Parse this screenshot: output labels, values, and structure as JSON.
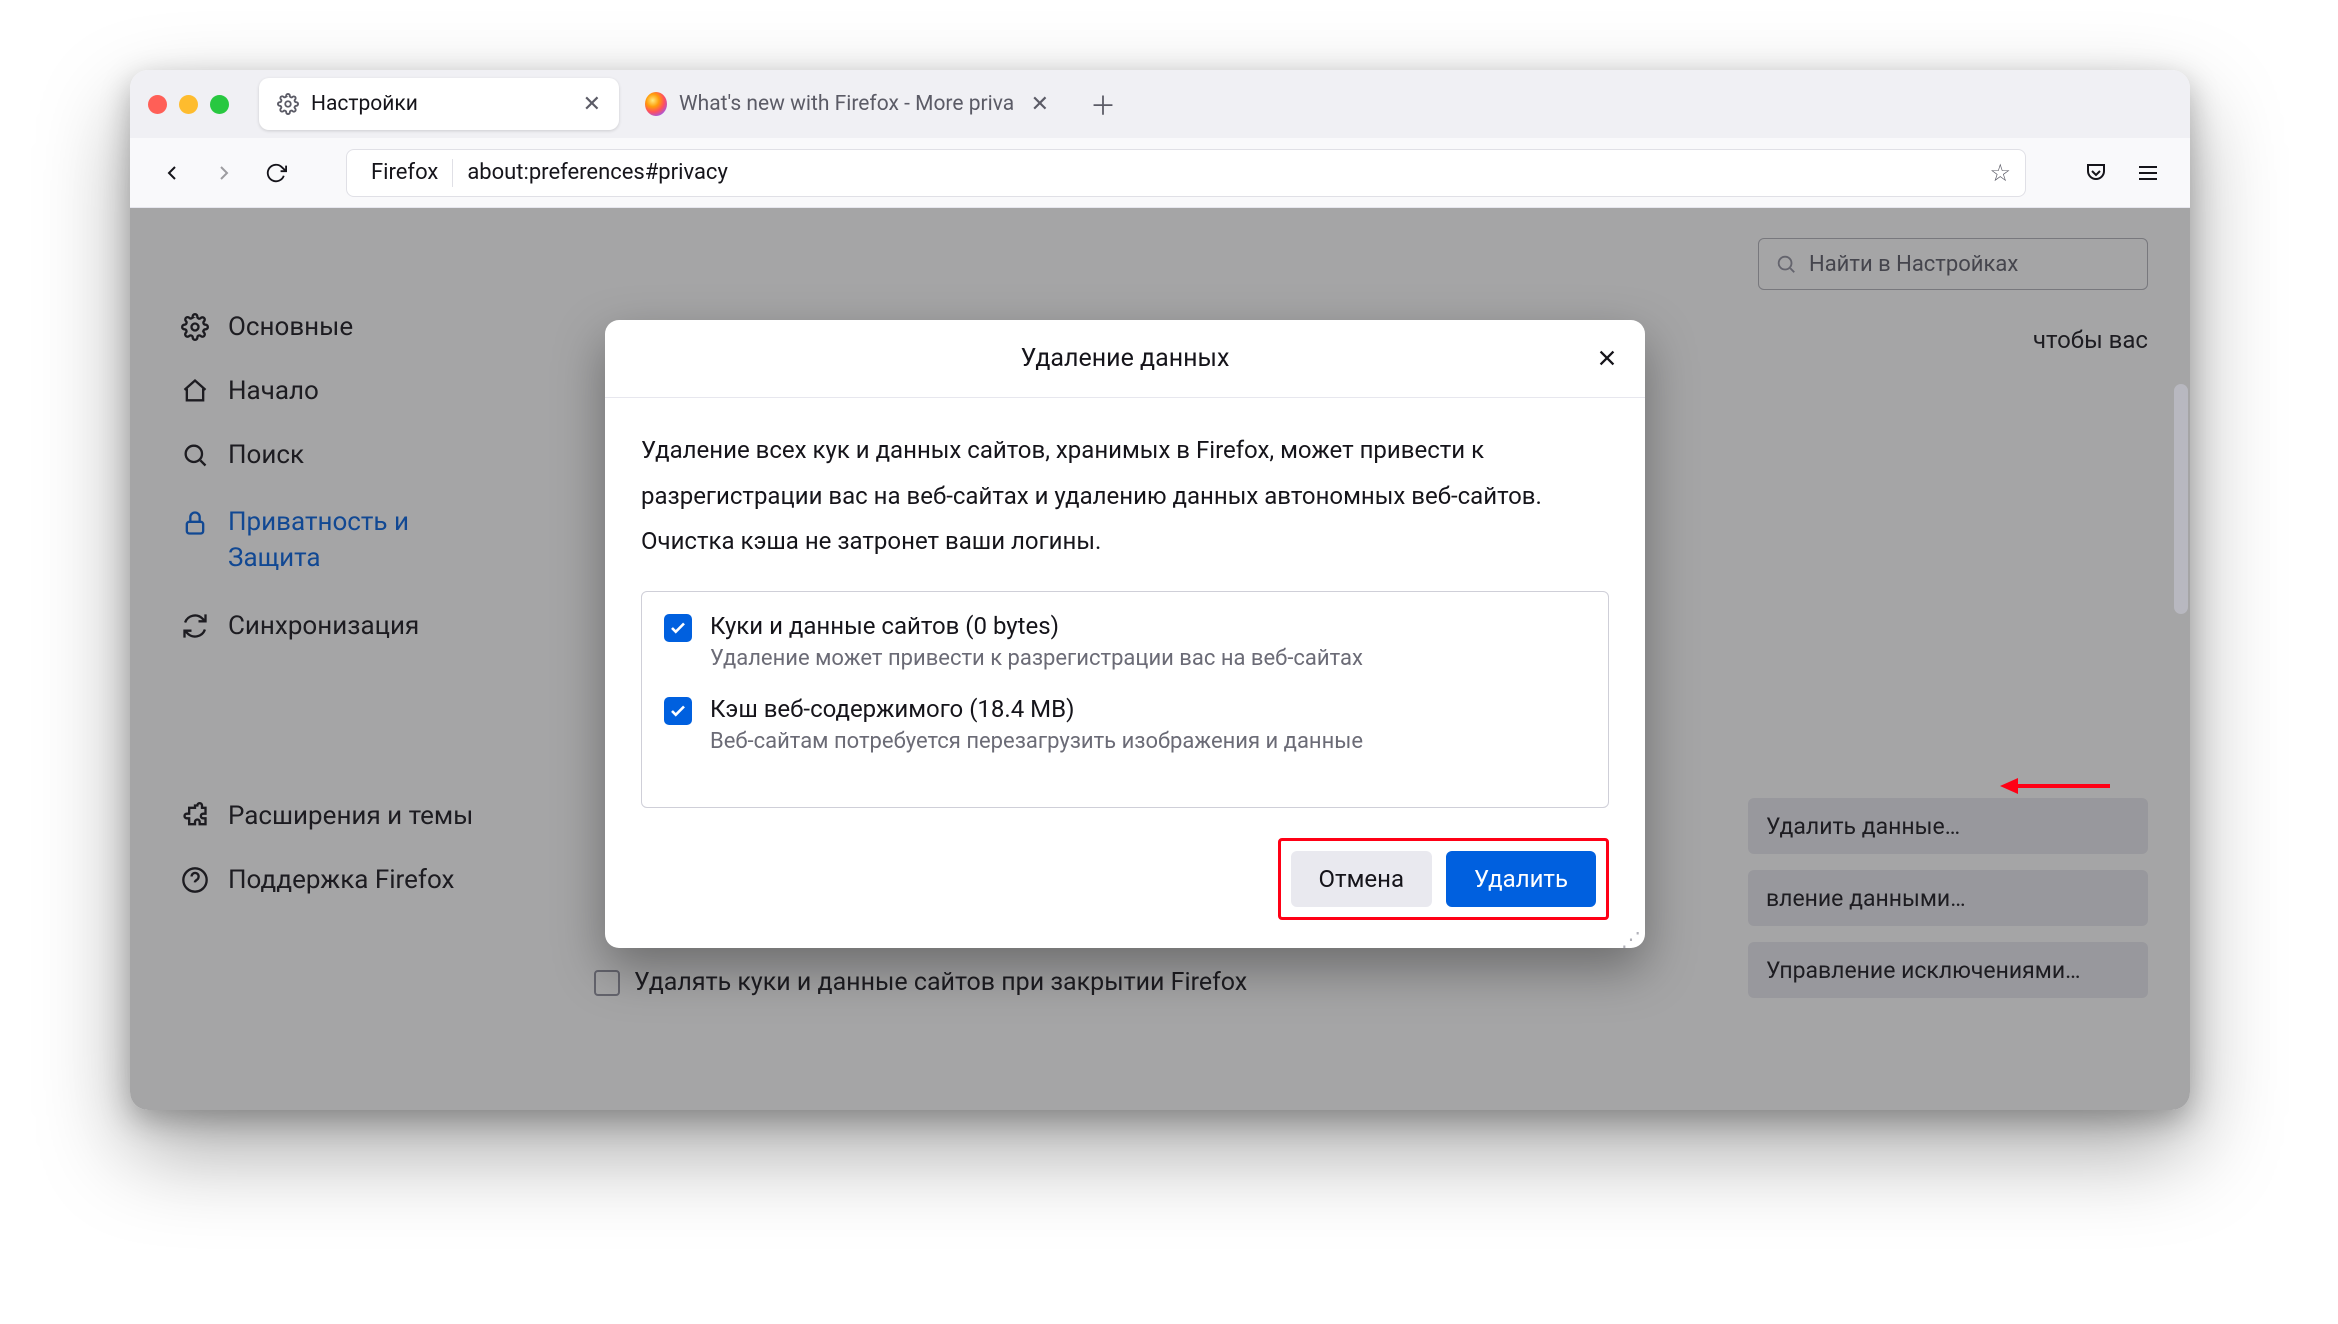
{
  "tabs": [
    {
      "label": "Настройки",
      "active": true
    },
    {
      "label": "What's new with Firefox - More priva",
      "active": false
    }
  ],
  "url": {
    "identity": "Firefox",
    "address": "about:preferences#privacy"
  },
  "search": {
    "placeholder": "Найти в Настройках"
  },
  "sidebar": {
    "items": [
      {
        "label": "Основные"
      },
      {
        "label": "Начало"
      },
      {
        "label": "Поиск"
      },
      {
        "label": "Приватность и Защита"
      },
      {
        "label": "Синхронизация"
      }
    ],
    "footer": [
      {
        "label": "Расширения и темы"
      },
      {
        "label": "Поддержка Firefox"
      }
    ]
  },
  "bg": {
    "fragment": "чтобы вас",
    "buttons": [
      "Удалить данные…",
      "вление данными…",
      "Управление исключениями…"
    ],
    "checkbox": "Удалять куки и данные сайтов при закрытии Firefox"
  },
  "dialog": {
    "title": "Удаление данных",
    "description": "Удаление всех кук и данных сайтов, хранимых в Firefox, может привести к разрегистрации вас на веб-сайтах и удалению данных автономных веб-сайтов. Очистка кэша не затронет ваши логины.",
    "options": [
      {
        "title": "Куки и данные сайтов (0 bytes)",
        "subtitle": "Удаление может привести к разрегистрации вас на веб-сайтах"
      },
      {
        "title": "Кэш веб-содержимого (18.4 MB)",
        "subtitle": "Веб-сайтам потребуется перезагрузить изображения и данные"
      }
    ],
    "cancel": "Отмена",
    "confirm": "Удалить"
  }
}
